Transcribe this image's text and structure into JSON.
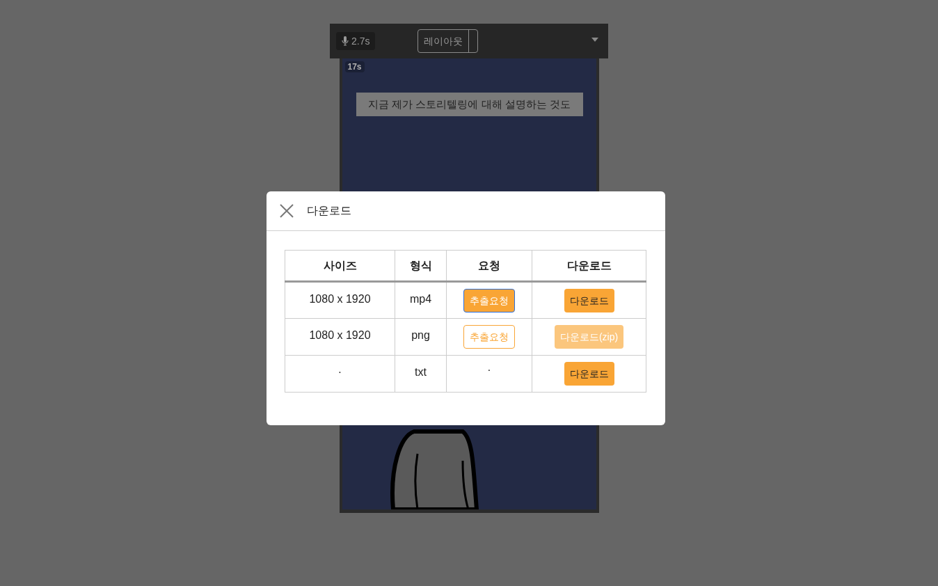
{
  "toolbar": {
    "mic_time": "2.7s",
    "layout_button": "레이아웃"
  },
  "video": {
    "time_badge": "17s",
    "caption": "지금 제가 스토리텔링에 대해 설명하는 것도"
  },
  "dialog": {
    "title": "다운로드",
    "table": {
      "columns": [
        "사이즈",
        "형식",
        "요청",
        "다운로드"
      ],
      "rows": [
        {
          "size": "1080 x 1920",
          "format": "mp4",
          "request": {
            "kind": "filled",
            "label": "추출요청",
            "focused": true
          },
          "download": {
            "label": "다운로드",
            "disabled": false
          }
        },
        {
          "size": "1080 x 1920",
          "format": "png",
          "request": {
            "kind": "outline",
            "label": "추출요청",
            "focused": false
          },
          "download": {
            "label": "다운로드(zip)",
            "disabled": true
          }
        },
        {
          "size": "·",
          "format": "txt",
          "request": {
            "kind": "text",
            "label": "·"
          },
          "download": {
            "label": "다운로드",
            "disabled": false
          }
        }
      ]
    }
  }
}
